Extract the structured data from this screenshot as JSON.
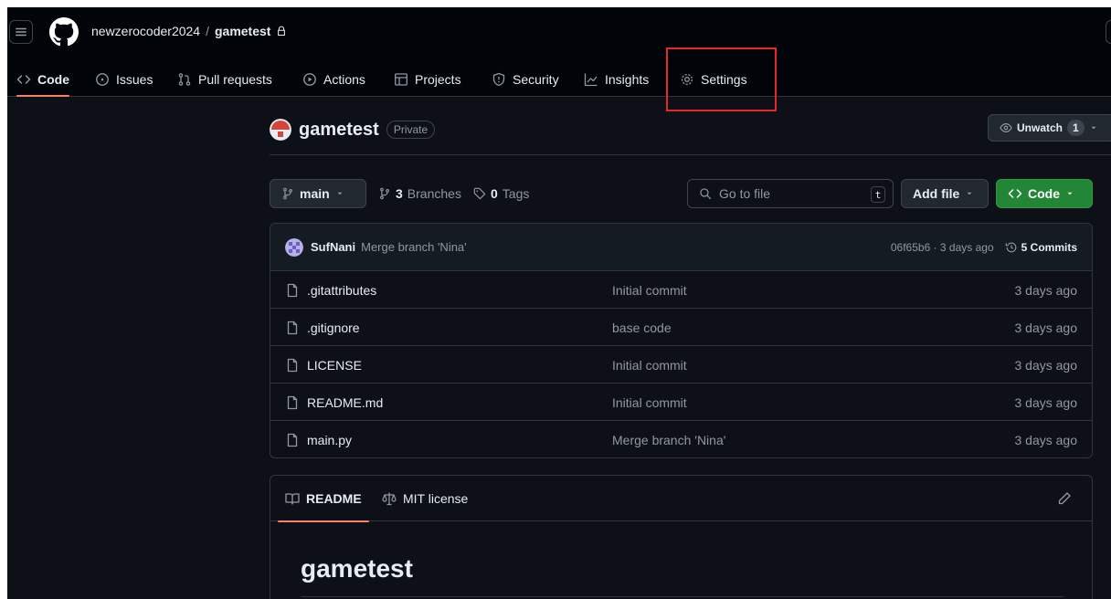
{
  "header": {
    "owner": "newzerocoder2024",
    "separator": "/",
    "repo": "gametest"
  },
  "tabs": [
    {
      "label": "Code"
    },
    {
      "label": "Issues"
    },
    {
      "label": "Pull requests"
    },
    {
      "label": "Actions"
    },
    {
      "label": "Projects"
    },
    {
      "label": "Security"
    },
    {
      "label": "Insights"
    },
    {
      "label": "Settings"
    }
  ],
  "repo": {
    "title": "gametest",
    "visibility": "Private",
    "unwatch_label": "Unwatch",
    "watchers": "1"
  },
  "branchbar": {
    "branch": "main",
    "branches_count": "3",
    "branches_label": "Branches",
    "tags_count": "0",
    "tags_label": "Tags",
    "search_placeholder": "Go to file",
    "search_key": "t",
    "add_file": "Add file",
    "code_button": "Code"
  },
  "commit": {
    "author": "SufNani",
    "message": "Merge branch 'Nina'",
    "meta": "06f65b6 · 3 days ago",
    "commits": "5 Commits"
  },
  "files": [
    {
      "name": ".gitattributes",
      "message": "Initial commit",
      "date": "3 days ago"
    },
    {
      "name": ".gitignore",
      "message": "base code",
      "date": "3 days ago"
    },
    {
      "name": "LICENSE",
      "message": "Initial commit",
      "date": "3 days ago"
    },
    {
      "name": "README.md",
      "message": "Initial commit",
      "date": "3 days ago"
    },
    {
      "name": "main.py",
      "message": "Merge branch 'Nina'",
      "date": "3 days ago"
    }
  ],
  "readme": {
    "tab_readme": "README",
    "tab_license": "MIT license",
    "heading": "gametest"
  },
  "colors": {
    "accent_underline": "#f78166",
    "green_button": "#238636",
    "highlight_box": "#e5262a",
    "background": "#0d1117"
  }
}
